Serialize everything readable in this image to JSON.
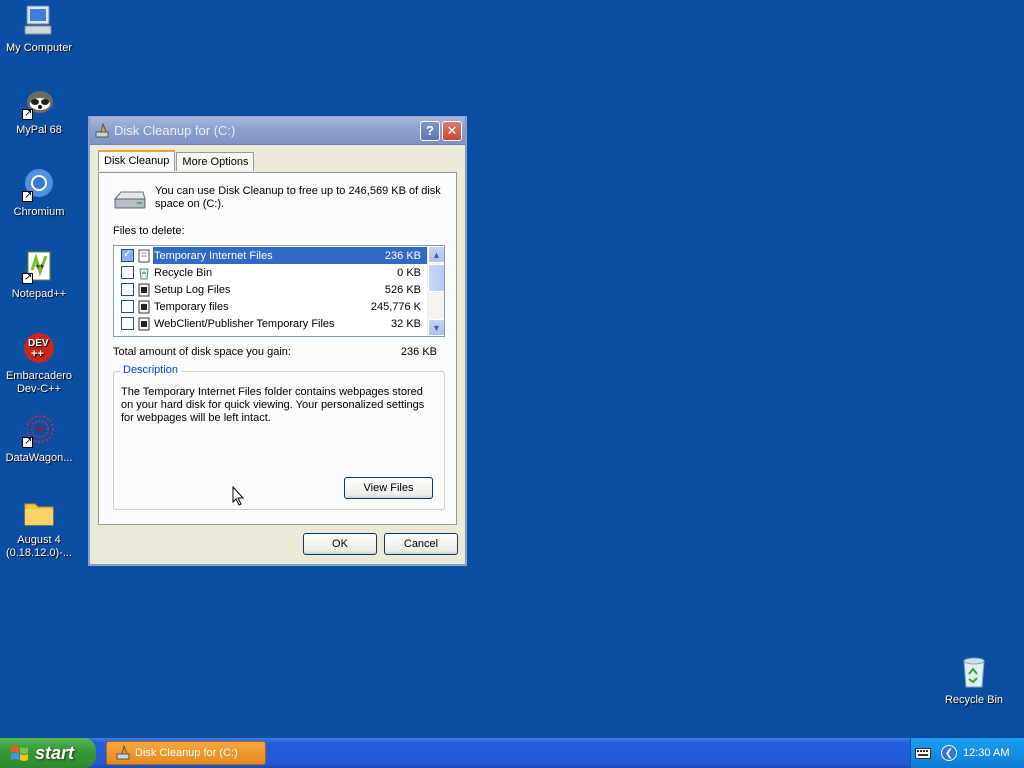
{
  "desktop": {
    "icons": [
      {
        "label": "My Computer",
        "icon": "computer-icon"
      },
      {
        "label": "MyPal 68",
        "icon": "mypal-icon"
      },
      {
        "label": "Chromium",
        "icon": "chromium-icon"
      },
      {
        "label": "Notepad++",
        "icon": "notepad-plus-plus-icon"
      },
      {
        "label": "Embarcadero Dev-C++",
        "icon": "dev-cpp-icon",
        "badge": "DEV\n++"
      },
      {
        "label": "DataWagon...",
        "icon": "datawagon-icon"
      },
      {
        "label": "August 4 (0.18.12.0)-...",
        "icon": "folder-icon"
      },
      {
        "label": "Recycle Bin",
        "icon": "recycle-bin-icon"
      }
    ]
  },
  "window": {
    "title": "Disk Cleanup for  (C:)",
    "help_btn": "?",
    "close_btn": "✕",
    "tabs": [
      {
        "label": "Disk Cleanup",
        "active": true
      },
      {
        "label": "More Options",
        "active": false
      }
    ],
    "intro_text": "You can use Disk Cleanup to free up to 246,569 KB of disk space on  (C:).",
    "files_label": "Files to delete:",
    "files": [
      {
        "name": "Temporary Internet Files",
        "size": "236 KB",
        "checked": true,
        "selected": true
      },
      {
        "name": "Recycle Bin",
        "size": "0 KB",
        "checked": false,
        "selected": false
      },
      {
        "name": "Setup Log Files",
        "size": "526 KB",
        "checked": false,
        "selected": false
      },
      {
        "name": "Temporary files",
        "size": "245,776 K",
        "checked": false,
        "selected": false
      },
      {
        "name": "WebClient/Publisher Temporary Files",
        "size": "32 KB",
        "checked": false,
        "selected": false
      }
    ],
    "total_label": "Total amount of disk space you gain:",
    "total_value": "236 KB",
    "description_legend": "Description",
    "description_text": "The Temporary Internet Files folder contains webpages stored on your hard disk for quick viewing. Your personalized settings for webpages will be left intact.",
    "view_files_label": "View Files",
    "ok_label": "OK",
    "cancel_label": "Cancel"
  },
  "taskbar": {
    "start_label": "start",
    "task_label": "Disk Cleanup for  (C:)",
    "clock": "12:30 AM"
  },
  "colors": {
    "desktop_bg": "#0b4fa3",
    "selection": "#316ac5",
    "tab_accent": "#ff9d2b",
    "start_green": "#3a9a3a"
  }
}
